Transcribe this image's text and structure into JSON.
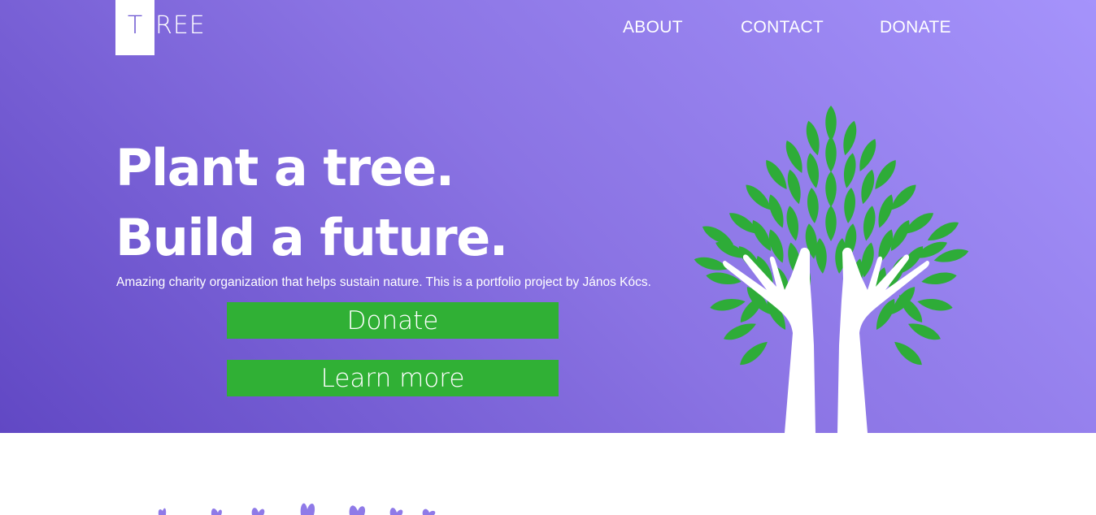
{
  "logo": {
    "first_letter": "T",
    "rest": "REE"
  },
  "nav": {
    "about": "ABOUT",
    "contact": "CONTACT",
    "donate": "DONATE"
  },
  "hero": {
    "headline_line1": "Plant a tree.",
    "headline_line2": "Build a future.",
    "subtitle": "Amazing charity organization that helps sustain nature. This is a portfolio project by János Kócs.",
    "donate_button": "Donate",
    "learn_more_button": "Learn more"
  },
  "colors": {
    "gradient_start": "#6148c4",
    "gradient_end": "#a593fb",
    "button_green": "#30b035",
    "leaf_green": "#2eac38",
    "text_white": "#ffffff",
    "bottom_plant_purple": "#8f7ae8"
  },
  "icons": {
    "tree_illustration": "tree-hands-illustration",
    "bottom_illustration": "purple-plants-illustration"
  }
}
